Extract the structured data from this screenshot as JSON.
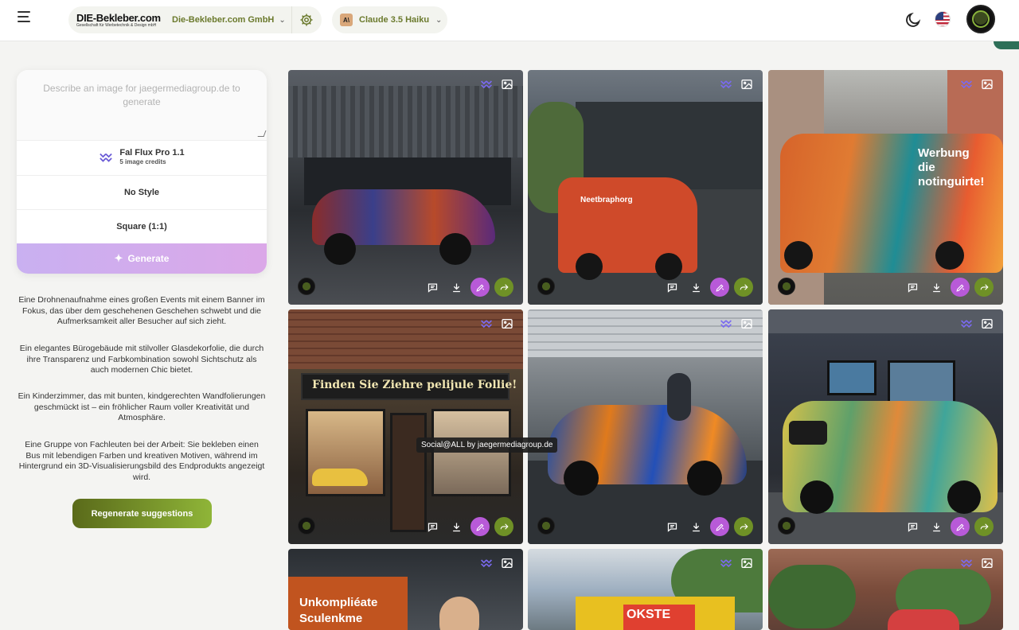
{
  "header": {
    "logo_main": "DIE-Bekleber.com",
    "logo_sub": "Gesellschaft für Werbetechnik & Design mbH",
    "org_name": "Die-Bekleber.com GmbH",
    "model_badge": "A\\",
    "model_name": "Claude 3.5 Haiku"
  },
  "composer": {
    "prompt_placeholder": "Describe an image for jaegermediagroup.de to generate",
    "model_name": "Fal Flux Pro 1.1",
    "model_credits": "5 image credits",
    "style": "No Style",
    "aspect_ratio": "Square (1:1)",
    "generate_label": "Generate"
  },
  "suggestions": [
    "Eine Drohnenaufnahme eines großen Events mit einem Banner im Fokus, das über dem geschehenen Geschehen schwebt und die Aufmerksamkeit aller Besucher auf sich zieht.",
    "Ein elegantes Bürogebäude mit stilvoller Glasdekorfolie, die durch ihre Transparenz und Farbkombination sowohl Sichtschutz als auch modernen Chic bietet.",
    "Ein Kinderzimmer, das mit bunten, kindgerechten Wandfolierungen geschmückt ist – ein fröhlicher Raum voller Kreativität und Atmosphäre.",
    "Eine Gruppe von Fachleuten bei der Arbeit: Sie bekleben einen Bus mit lebendigen Farben und kreativen Motiven, während im Hintergrund ein 3D-Visualisierungsbild des Endprodukts angezeigt wird."
  ],
  "regenerate_label": "Regenerate suggestions",
  "gallery": {
    "tooltip": "Social@ALL by jaegermediagroup.de",
    "image_texts": {
      "van_red": "Neetbraphorg",
      "van_colorful_line1": "Werbung",
      "van_colorful_line2": "die",
      "van_colorful_line3": "notinguirte!",
      "shop_sign": "Finden Sie Ziehre pelijule Follie!",
      "office_sign_line1": "Unkompliéate",
      "office_sign_line2": "Sculenkme",
      "truck_sign": "OKSTE"
    }
  }
}
